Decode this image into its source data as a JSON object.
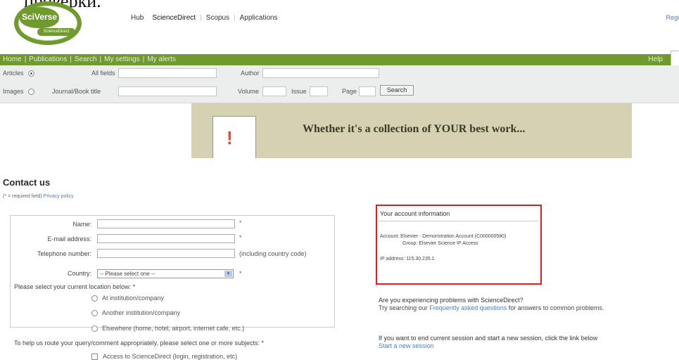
{
  "caption_fragment": "проверки.",
  "brand": {
    "logo_main": "SciVerse",
    "logo_sub": "ScienceDirect"
  },
  "top_nav": {
    "items": [
      "Hub",
      "ScienceDirect",
      "Scopus",
      "Applications"
    ],
    "right_link": "Regi"
  },
  "main_nav": {
    "items": [
      "Home",
      "Publications",
      "Search",
      "My settings",
      "My alerts"
    ],
    "help": "Help"
  },
  "search": {
    "scope_articles": "Articles",
    "scope_images": "Images",
    "all_fields": "All fields",
    "author": "Author",
    "journal_book_title": "Journal/Book title",
    "volume": "Volume",
    "issue": "Issue",
    "page": "Page",
    "button": "Search"
  },
  "banner": {
    "text": "Whether it's a collection of YOUR best work..."
  },
  "contact": {
    "title": "Contact us",
    "required_note": "(* = required field)",
    "privacy_link": "Privacy policy"
  },
  "form": {
    "name_label": "Name:",
    "email_label": "E-mail address:",
    "phone_label": "Telephone number:",
    "phone_note": "(including country code)",
    "country_label": "Country:",
    "country_select": "-- Please select one --",
    "location_prompt": "Please select your current location below: *",
    "location_options": [
      "At institution/company",
      "Another institution/company",
      "Elsewhere (home, hotel, airport, internet cafe, etc.)"
    ],
    "subject_prompt": "To help us route your query/comment appropriately, please select one or more subjects: *",
    "subject_first": "Access to ScienceDirect (login, registration, etc)",
    "required_star": "*"
  },
  "account": {
    "heading": "Your account information",
    "line1": "Account: Elsevier - Demonstration Account (C000000580)",
    "line2": "Group: Elsevier Science IP Access",
    "line3": "IP address: 115.30.235.1"
  },
  "side": {
    "q_line": "Are you experiencing problems with ScienceDirect?",
    "q_help_pre": "Try searching our ",
    "q_help_link": "Frequently asked questions",
    "q_help_post": " for answers to common problems.",
    "session_text": "If you want to end current session and start a new session, click the link below",
    "session_link": "Start a new session"
  }
}
